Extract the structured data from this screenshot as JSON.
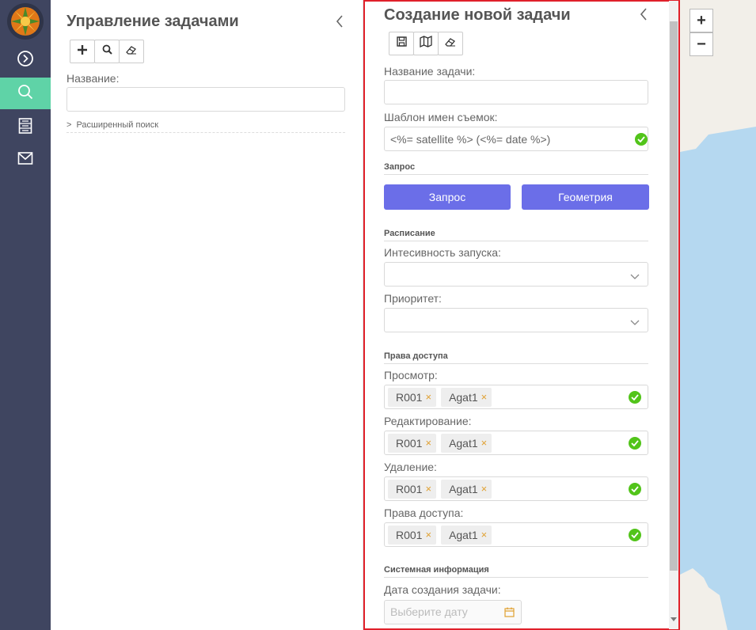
{
  "sidebar": {
    "items": [
      {
        "icon": "chevron-right-circle-icon"
      },
      {
        "icon": "search-icon",
        "active": true
      },
      {
        "icon": "list-icon"
      },
      {
        "icon": "mail-icon"
      }
    ],
    "accent": "#5fd3a7",
    "background": "#3f4560"
  },
  "task_panel": {
    "title": "Управление задачами",
    "toolbar": [
      "plus-icon",
      "search-icon",
      "eraser-icon"
    ],
    "name_label": "Название:",
    "name_value": "",
    "advanced_search": "Расширенный поиск"
  },
  "create_panel": {
    "title": "Создание новой задачи",
    "toolbar": [
      "save-icon",
      "map-icon",
      "eraser-icon"
    ],
    "task_name_label": "Название задачи:",
    "task_name_value": "",
    "template_label": "Шаблон имен съемок:",
    "template_value": "<%= satellite %> (<%= date %>)",
    "request_section": "Запрос",
    "request_button": "Запрос",
    "geometry_button": "Геометрия",
    "schedule_section": "Расписание",
    "intensity_label": "Интесивность запуска:",
    "priority_label": "Приоритет:",
    "access_section": "Права доступа",
    "access_fields": [
      {
        "label": "Просмотр:",
        "tags": [
          "R001",
          "Agat1"
        ]
      },
      {
        "label": "Редактирование:",
        "tags": [
          "R001",
          "Agat1"
        ]
      },
      {
        "label": "Удаление:",
        "tags": [
          "R001",
          "Agat1"
        ]
      },
      {
        "label": "Права доступа:",
        "tags": [
          "R001",
          "Agat1"
        ]
      }
    ],
    "system_section": "Системная информация",
    "created_date_label": "Дата создания задачи:",
    "date_placeholder": "Выберите дату",
    "accent": "#6b6ee8",
    "valid_color": "#52c41a"
  },
  "map": {
    "zoom_in": "+",
    "zoom_out": "−",
    "water_color": "#b5d8f0"
  }
}
